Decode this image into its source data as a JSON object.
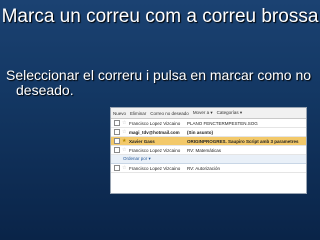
{
  "slide": {
    "title": "Marca un correu com a correu brossa",
    "bullet": "Seleccionar el correru i pulsa en marcar como no deseado."
  },
  "mail": {
    "toolbar": [
      "Nuevo",
      "Eliminar",
      "Correo no deseado",
      "Mover a ▾",
      "Categorías ▾"
    ],
    "rows": [
      {
        "from": "Francisco Lopez Vizcaino",
        "subject": "PLANO FENCTERMPESTEN.SOG",
        "selected": false,
        "bold": false
      },
      {
        "from": "magi_tdv@hotmail.com",
        "subject": "(Sin asunto)",
        "selected": false,
        "bold": true
      },
      {
        "from": "Xavier Gass",
        "subject": "ORIGINPROGRES. Saupiro Script amb 3 parametres",
        "selected": true,
        "bold": true
      },
      {
        "from": "Francisco Lopez Vizcaino",
        "subject": "RV: Matemáticas",
        "selected": false,
        "bold": false
      }
    ],
    "sort_label": "Ordenar por ▾",
    "last_row": {
      "from": "Francisco Lopez Vizcaino",
      "subject": "RV: Autorización",
      "selected": false,
      "bold": false
    }
  }
}
